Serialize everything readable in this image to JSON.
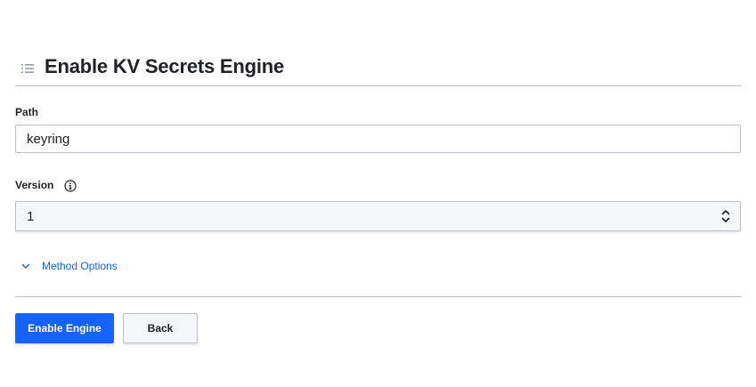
{
  "page": {
    "title": "Enable KV Secrets Engine",
    "title_icon": "list-icon"
  },
  "form": {
    "path": {
      "label": "Path",
      "value": "keyring"
    },
    "version": {
      "label": "Version",
      "info_icon": "info-icon",
      "value": "1",
      "select_icon": "chevron-up-down-icon"
    },
    "method_options": {
      "label": "Method Options",
      "icon": "chevron-down-icon",
      "expanded": false
    }
  },
  "actions": {
    "enable_label": "Enable Engine",
    "back_label": "Back"
  },
  "colors": {
    "accent": "#1563ff",
    "text": "#1f2124",
    "border": "#bac1cc",
    "divider": "#babfc4"
  }
}
